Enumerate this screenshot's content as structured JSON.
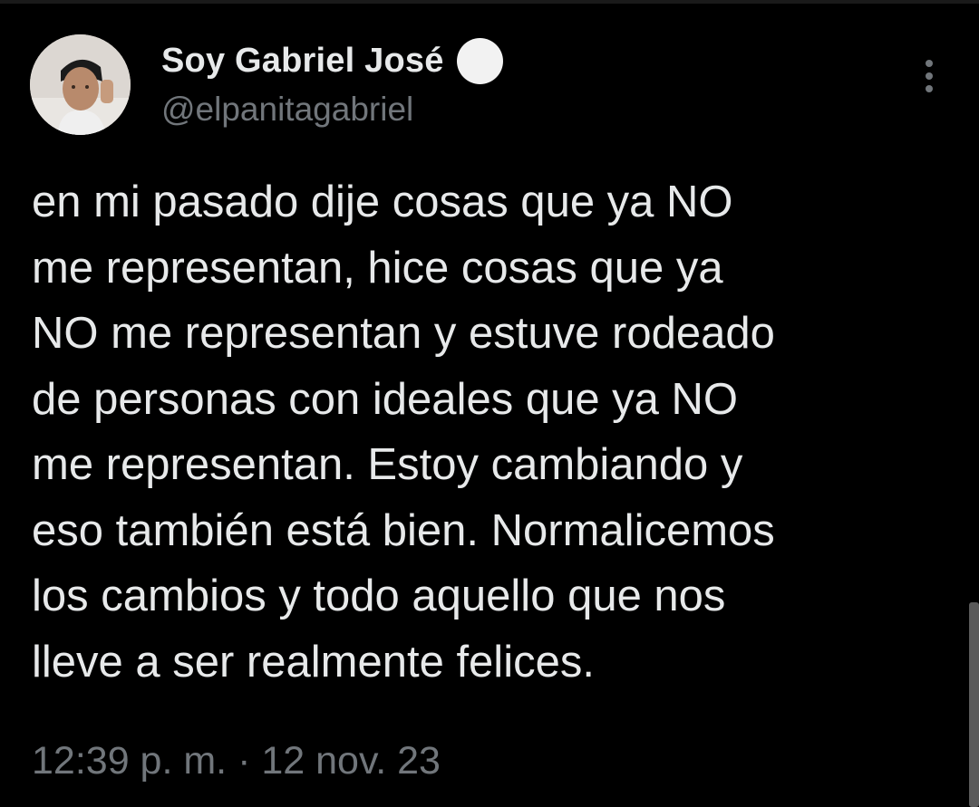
{
  "tweet": {
    "author": {
      "display_name": "Soy Gabriel José",
      "handle": "@elpanitagabriel",
      "verified": true
    },
    "text_lines": [
      "en mi pasado dije cosas que ya NO",
      "me representan, hice cosas que ya",
      "NO me representan y estuve rodeado",
      "de personas con ideales que ya NO",
      "me representan. Estoy cambiando y",
      "eso también está bien. Normalicemos",
      "los cambios y todo aquello que nos",
      "lleve a ser realmente felices."
    ],
    "timestamp": "12:39 p. m. · 12 nov. 23"
  },
  "icons": {
    "more": "more-vertical-icon",
    "verified": "verified-badge-icon"
  },
  "colors": {
    "background": "#000000",
    "primary_text": "#e7e9ea",
    "secondary_text": "#71767b",
    "badge": "#f2f2f2"
  }
}
